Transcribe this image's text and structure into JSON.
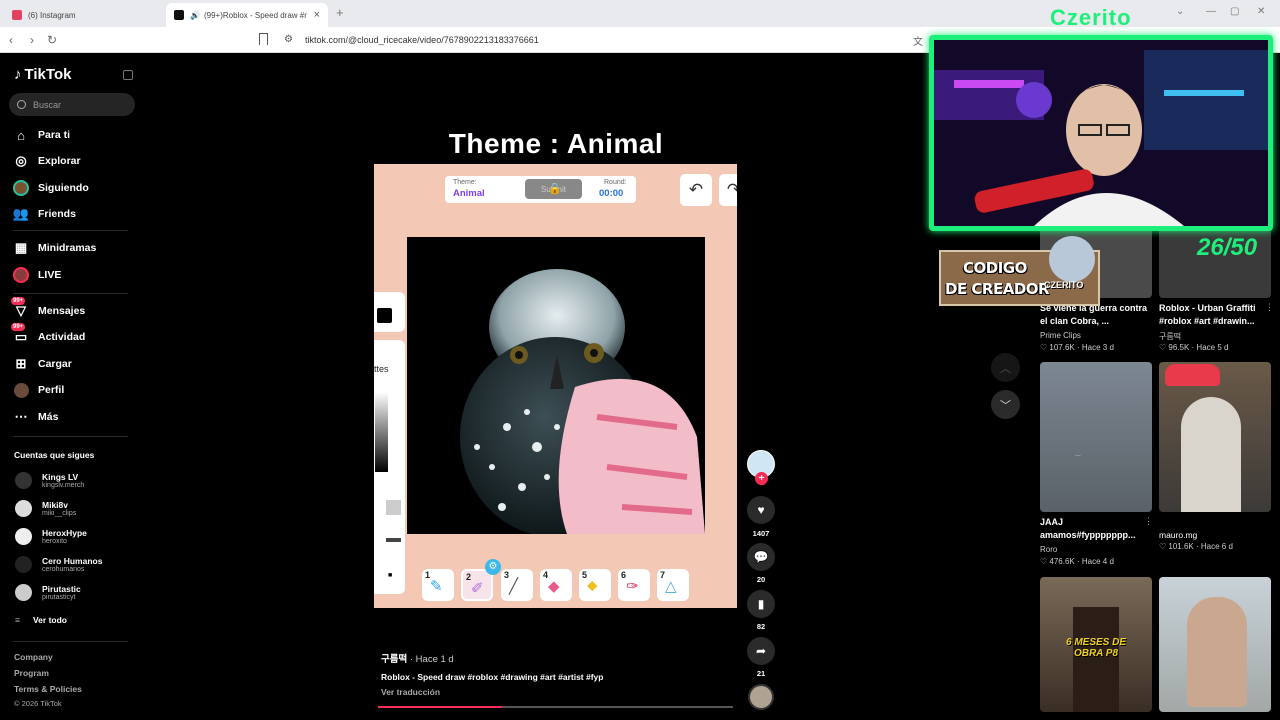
{
  "browser": {
    "tabs": [
      {
        "label": "(6) Instagram",
        "favicon_color": "#e4405f"
      },
      {
        "label": "(99+)Roblox - Speed draw #r",
        "favicon_color": "#111111"
      }
    ],
    "new_tab": "+",
    "url": "tiktok.com/@cloud_ricecake/video/7678902213183376661"
  },
  "sidebar": {
    "logo": "TikTok",
    "search_placeholder": "Buscar",
    "nav": [
      {
        "label": "Para ti",
        "icon": "home-icon"
      },
      {
        "label": "Explorar",
        "icon": "compass-icon"
      },
      {
        "label": "Siguiendo",
        "icon": "following-avatar-icon"
      },
      {
        "label": "Friends",
        "icon": "friends-icon"
      },
      {
        "label": "Minidramas",
        "icon": "minidramas-icon"
      },
      {
        "label": "LIVE",
        "icon": "live-avatar-icon"
      },
      {
        "label": "Mensajes",
        "icon": "messages-icon",
        "badge": "99+"
      },
      {
        "label": "Actividad",
        "icon": "activity-icon",
        "badge": "99+"
      },
      {
        "label": "Cargar",
        "icon": "upload-icon"
      },
      {
        "label": "Perfil",
        "icon": "profile-icon"
      },
      {
        "label": "Más",
        "icon": "more-icon"
      }
    ],
    "following_title": "Cuentas que sigues",
    "following": [
      {
        "name": "Kings LV",
        "handle": "kingslv.merch"
      },
      {
        "name": "Miki8v",
        "handle": "miki__clips"
      },
      {
        "name": "HeroxHype",
        "handle": "heroxito"
      },
      {
        "name": "Cero Humanos",
        "handle": "cerohumanos"
      },
      {
        "name": "Pirutastic",
        "handle": "pirutasticyt"
      }
    ],
    "see_all": "Ver todo",
    "footer_links": [
      "Company",
      "Program",
      "Terms & Policies"
    ],
    "copyright": "© 2026 TikTok"
  },
  "video": {
    "overlay_title": "Theme : Animal",
    "game": {
      "theme_label": "Theme:",
      "theme_value": "Animal",
      "submit": "Submit",
      "round_label": "Round:",
      "round_value": "00:00",
      "sidebar_text": "ttes",
      "tools": [
        "1",
        "2",
        "3",
        "4",
        "5",
        "6",
        "7"
      ]
    },
    "author": "구름떡",
    "time": " · Hace 1 d",
    "caption": "Roblox - Speed draw #roblox #drawing #art #artist #fyp",
    "translate": "Ver traducción",
    "progress": 0.35
  },
  "actions": {
    "likes": "1407",
    "comments": "20",
    "saves": "82",
    "shares": "21"
  },
  "grid": [
    {
      "title": "Se viene la guerra contra el clan Cobra, ...",
      "author": "Prime Clips",
      "views": "107.6K",
      "ago": "Hace 3 d"
    },
    {
      "title": "Roblox - Urban Graffiti #roblox #art #drawin...",
      "author": "구름떡",
      "views": "96.5K",
      "ago": "Hace 5 d"
    },
    {
      "title": "JAAJ amamos#fyppppppp...",
      "author": "Roro",
      "views": "476.6K",
      "ago": "Hace 4 d"
    },
    {
      "title": "mauro.mg",
      "author": "",
      "views": "101.6K",
      "ago": "Hace 6 d"
    },
    {
      "overlay_text": "6 MESES DE OBRA P8"
    },
    {}
  ],
  "stream_overlay": {
    "brand": "Czerito",
    "counter": "26/50",
    "codigo_line1": "CODIGO",
    "codigo_line2": "DE CREADOR",
    "codigo_name": "CZERITO",
    "accent": "#1df07a"
  }
}
